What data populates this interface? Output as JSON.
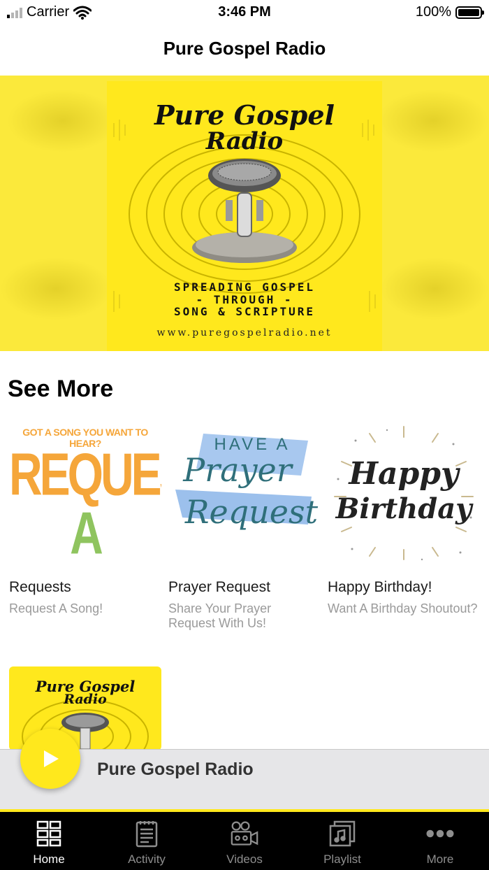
{
  "status_bar": {
    "carrier": "Carrier",
    "time": "3:46 PM",
    "battery": "100%"
  },
  "nav": {
    "title": "Pure Gospel Radio"
  },
  "hero": {
    "brand_line1": "Pure Gospel",
    "brand_line2": "Radio",
    "tagline_line1": "SPREADING GOSPEL",
    "tagline_line2": "- THROUGH -",
    "tagline_line3": "SONG & SCRIPTURE",
    "url": "www.puregospelradio.net",
    "color": "#ffe81d"
  },
  "see_more": {
    "title": "See More",
    "cards": [
      {
        "title": "Requests",
        "subtitle": "Request A Song!",
        "art_line1": "GOT A SONG YOU WANT TO HEAR?",
        "art_line2": "REQUEST",
        "art_line3": "A SONG"
      },
      {
        "title": "Prayer Request",
        "subtitle": "Share Your Prayer Request With Us!",
        "art_line1": "HAVE A",
        "art_line2": "Prayer",
        "art_line3": "Request"
      },
      {
        "title": "Happy Birthday!",
        "subtitle": "Want A Birthday Shoutout?",
        "art_line1": "Happy",
        "art_line2": "Birthday"
      }
    ],
    "partial_card": {
      "art_line1": "Pure Gospel",
      "art_line2": "Radio"
    }
  },
  "player": {
    "title": "Pure Gospel Radio",
    "accent": "#ffe81d"
  },
  "tabs": [
    {
      "label": "Home",
      "icon": "grid-icon",
      "active": true
    },
    {
      "label": "Activity",
      "icon": "notepad-icon",
      "active": false
    },
    {
      "label": "Videos",
      "icon": "video-camera-icon",
      "active": false
    },
    {
      "label": "Playlist",
      "icon": "playlist-icon",
      "active": false
    },
    {
      "label": "More",
      "icon": "ellipsis-icon",
      "active": false
    }
  ]
}
